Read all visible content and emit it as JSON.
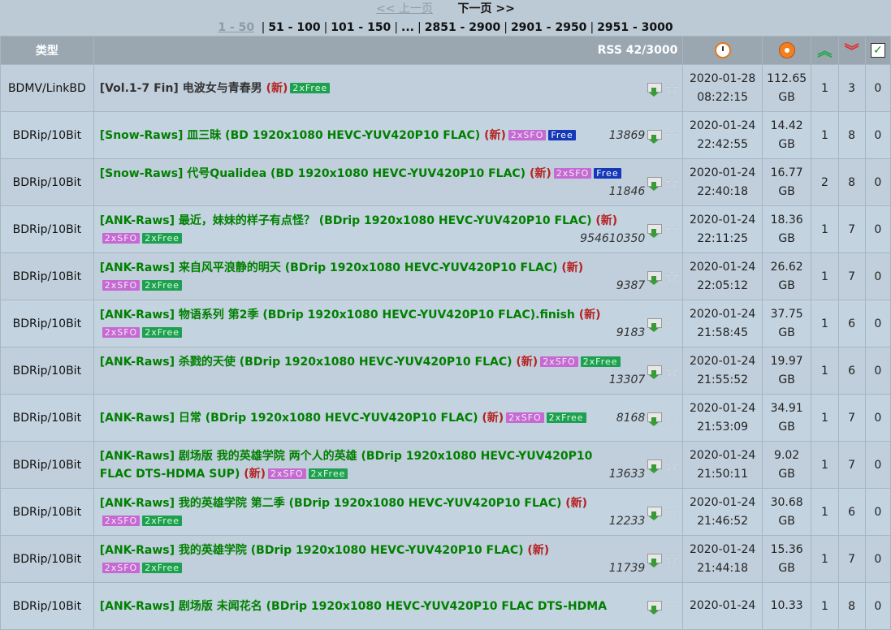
{
  "pager": {
    "prev": "<< 上一页",
    "next": "下一页 >>",
    "current": "1 - 50",
    "pages": [
      "51 - 100",
      "101 - 150",
      "...",
      "2851 - 2900",
      "2901 - 2950",
      "2951 - 3000"
    ]
  },
  "header": {
    "type": "类型",
    "rss": "RSS 42/3000",
    "icons": [
      "clock-icon",
      "size-disc-icon",
      "seeders-up-icon",
      "leechers-down-icon",
      "completed-check-icon"
    ]
  },
  "rows": [
    {
      "cat": "BDMV/LinkBD",
      "title": "[Vol.1-7 Fin] 电波女与青春男",
      "new": "(新)",
      "badges": [
        "2xFree"
      ],
      "num": "",
      "date": "2020-01-28",
      "time": "08:22:15",
      "size": "112.65",
      "unit": "GB",
      "up": "1",
      "down": "3",
      "done": "0",
      "black": true,
      "split": false
    },
    {
      "cat": "BDRip/10Bit",
      "title": "[Snow-Raws] 皿三昧 (BD 1920x1080 HEVC-YUV420P10 FLAC)",
      "new": "(新)",
      "badges": [
        "2xSFO",
        "Free"
      ],
      "num": "13869",
      "date": "2020-01-24",
      "time": "22:42:55",
      "size": "14.42",
      "unit": "GB",
      "up": "1",
      "down": "8",
      "done": "0",
      "split": false
    },
    {
      "cat": "BDRip/10Bit",
      "title": "[Snow-Raws] 代号Qualidea (BD 1920x1080 HEVC-YUV420P10 FLAC)",
      "new": "(新)",
      "badges": [
        "2xSFO",
        "Free"
      ],
      "num": "11846",
      "date": "2020-01-24",
      "time": "22:40:18",
      "size": "16.77",
      "unit": "GB",
      "up": "2",
      "down": "8",
      "done": "0",
      "split": true,
      "badgesFirst": true
    },
    {
      "cat": "BDRip/10Bit",
      "title": "[ANK-Raws] 最近，妹妹的样子有点怪？ (BDrip 1920x1080 HEVC-YUV420P10 FLAC)",
      "new": "(新)",
      "badges": [
        "2xSFO",
        "2xFree"
      ],
      "num": "954610350",
      "date": "2020-01-24",
      "time": "22:11:25",
      "size": "18.36",
      "unit": "GB",
      "up": "1",
      "down": "7",
      "done": "0",
      "split": true
    },
    {
      "cat": "BDRip/10Bit",
      "title": "[ANK-Raws] 来自风平浪静的明天 (BDrip 1920x1080 HEVC-YUV420P10 FLAC)",
      "new": "(新)",
      "badges": [
        "2xSFO",
        "2xFree"
      ],
      "num": "9387",
      "date": "2020-01-24",
      "time": "22:05:12",
      "size": "26.62",
      "unit": "GB",
      "up": "1",
      "down": "7",
      "done": "0",
      "split": true
    },
    {
      "cat": "BDRip/10Bit",
      "title": "[ANK-Raws] 物语系列 第2季 (BDrip 1920x1080 HEVC-YUV420P10 FLAC).finish",
      "new": "(新)",
      "badges": [
        "2xSFO",
        "2xFree"
      ],
      "num": "9183",
      "date": "2020-01-24",
      "time": "21:58:45",
      "size": "37.75",
      "unit": "GB",
      "up": "1",
      "down": "6",
      "done": "0",
      "split": true
    },
    {
      "cat": "BDRip/10Bit",
      "title": "[ANK-Raws] 杀戮的天使 (BDrip 1920x1080 HEVC-YUV420P10 FLAC)",
      "new": "(新)",
      "badges": [
        "2xSFO",
        "2xFree"
      ],
      "num": "13307",
      "date": "2020-01-24",
      "time": "21:55:52",
      "size": "19.97",
      "unit": "GB",
      "up": "1",
      "down": "6",
      "done": "0",
      "split": true,
      "badgesFirst": true
    },
    {
      "cat": "BDRip/10Bit",
      "title": "[ANK-Raws] 日常 (BDrip 1920x1080 HEVC-YUV420P10 FLAC)",
      "new": "(新)",
      "badges": [
        "2xSFO",
        "2xFree"
      ],
      "num": "8168",
      "date": "2020-01-24",
      "time": "21:53:09",
      "size": "34.91",
      "unit": "GB",
      "up": "1",
      "down": "7",
      "done": "0",
      "split": false
    },
    {
      "cat": "BDRip/10Bit",
      "title": "[ANK-Raws] 剧场版 我的英雄学院 两个人的英雄 (BDrip 1920x1080 HEVC-YUV420P10",
      "title2": "FLAC DTS-HDMA SUP)",
      "new": "(新)",
      "badges": [
        "2xSFO",
        "2xFree"
      ],
      "num": "13633",
      "date": "2020-01-24",
      "time": "21:50:11",
      "size": "9.02",
      "unit": "GB",
      "up": "1",
      "down": "7",
      "done": "0",
      "split": true,
      "wrap": true
    },
    {
      "cat": "BDRip/10Bit",
      "title": "[ANK-Raws] 我的英雄学院 第二季 (BDrip 1920x1080 HEVC-YUV420P10 FLAC)",
      "new": "(新)",
      "badges": [
        "2xSFO",
        "2xFree"
      ],
      "num": "12233",
      "date": "2020-01-24",
      "time": "21:46:52",
      "size": "30.68",
      "unit": "GB",
      "up": "1",
      "down": "6",
      "done": "0",
      "split": true
    },
    {
      "cat": "BDRip/10Bit",
      "title": "[ANK-Raws] 我的英雄学院 (BDrip 1920x1080 HEVC-YUV420P10 FLAC)",
      "new": "(新)",
      "badges": [
        "2xSFO",
        "2xFree"
      ],
      "num": "11739",
      "date": "2020-01-24",
      "time": "21:44:18",
      "size": "15.36",
      "unit": "GB",
      "up": "1",
      "down": "7",
      "done": "0",
      "split": true
    },
    {
      "cat": "BDRip/10Bit",
      "title": "[ANK-Raws] 剧场版 未闻花名 (BDrip 1920x1080 HEVC-YUV420P10 FLAC DTS-HDMA",
      "new": "",
      "badges": [],
      "num": "",
      "date": "2020-01-24",
      "time": "",
      "size": "10.33",
      "unit": "",
      "up": "1",
      "down": "8",
      "done": "0",
      "split": false
    }
  ]
}
